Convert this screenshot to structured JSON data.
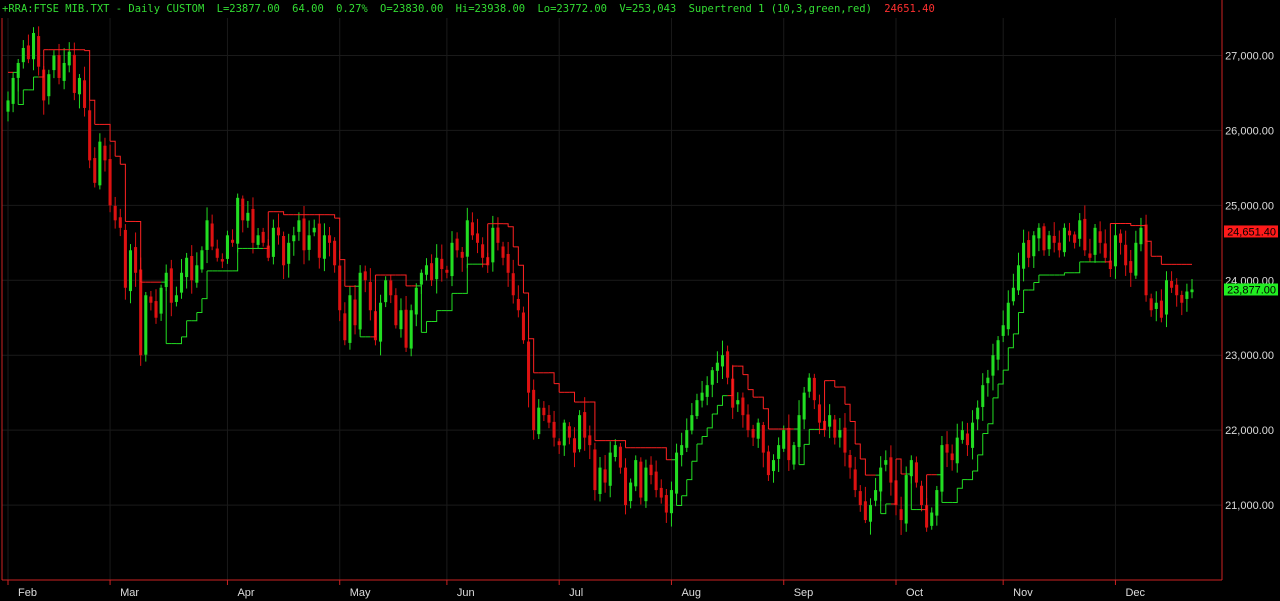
{
  "header": {
    "symbol": "+RRA:FTSE MIB.TXT - Daily  CUSTOM",
    "last": "L=23877.00",
    "change": "64.00",
    "change_pct": "0.27%",
    "open": "O=23830.00",
    "high": "Hi=23938.00",
    "low": "Lo=23772.00",
    "volume": "V=253,043",
    "indicator": "Supertrend 1 (10,3,green,red)",
    "indicator_value": "24651.40"
  },
  "colors": {
    "background": "#000000",
    "up": "#22dd22",
    "down": "#dd1111",
    "axis": "#cc2222",
    "grid": "#1a1a1a",
    "text": "#dddddd",
    "supertrend_up": "#22dd22",
    "supertrend_down": "#ff2222"
  },
  "chart_data": {
    "type": "candlestick",
    "x_ticks": [
      "Feb",
      "Mar",
      "Apr",
      "May",
      "Jun",
      "Jul",
      "Aug",
      "Sep",
      "Oct",
      "Nov",
      "Dec"
    ],
    "y_ticks": [
      "21,000.00",
      "22,000.00",
      "23,000.00",
      "24,000.00",
      "25,000.00",
      "26,000.00",
      "27,000.00"
    ],
    "ylim": [
      20000,
      27500
    ],
    "y_labels": {
      "supertrend": "24,651.40",
      "last": "23,877.00"
    },
    "supertrend_value": 24651.4,
    "last_value": 23877,
    "dates": [
      "02-01",
      "02-02",
      "02-03",
      "02-04",
      "02-05",
      "02-08",
      "02-09",
      "02-10",
      "02-11",
      "02-12",
      "02-15",
      "02-16",
      "02-17",
      "02-18",
      "02-19",
      "02-22",
      "02-23",
      "02-24",
      "02-25",
      "02-26",
      "03-01",
      "03-02",
      "03-03",
      "03-04",
      "03-05",
      "03-08",
      "03-09",
      "03-10",
      "03-11",
      "03-12",
      "03-15",
      "03-16",
      "03-17",
      "03-18",
      "03-19",
      "03-22",
      "03-23",
      "03-24",
      "03-25",
      "03-26",
      "03-29",
      "03-30",
      "03-31",
      "04-01",
      "04-02",
      "04-05",
      "04-06",
      "04-07",
      "04-08",
      "04-09",
      "04-12",
      "04-13",
      "04-14",
      "04-15",
      "04-16",
      "04-19",
      "04-20",
      "04-21",
      "04-22",
      "04-23",
      "04-26",
      "04-27",
      "04-28",
      "04-29",
      "04-30",
      "05-03",
      "05-04",
      "05-05",
      "05-06",
      "05-07",
      "05-10",
      "05-11",
      "05-12",
      "05-13",
      "05-14",
      "05-17",
      "05-18",
      "05-19",
      "05-20",
      "05-21",
      "05-24",
      "05-25",
      "05-26",
      "05-27",
      "05-28",
      "05-31",
      "06-01",
      "06-02",
      "06-03",
      "06-04",
      "06-07",
      "06-08",
      "06-09",
      "06-10",
      "06-11",
      "06-14",
      "06-15",
      "06-16",
      "06-17",
      "06-18",
      "06-21",
      "06-22",
      "06-23",
      "06-24",
      "06-25",
      "06-28",
      "06-29",
      "06-30",
      "07-01",
      "07-02",
      "07-05",
      "07-06",
      "07-07",
      "07-08",
      "07-09",
      "07-12",
      "07-13",
      "07-14",
      "07-15",
      "07-16",
      "07-19",
      "07-20",
      "07-21",
      "07-22",
      "07-23",
      "07-26",
      "07-27",
      "07-28",
      "07-29",
      "07-30",
      "08-02",
      "08-03",
      "08-04",
      "08-05",
      "08-06",
      "08-09",
      "08-10",
      "08-11",
      "08-12",
      "08-13",
      "08-16",
      "08-17",
      "08-18",
      "08-19",
      "08-20",
      "08-23",
      "08-24",
      "08-25",
      "08-26",
      "08-27",
      "08-30",
      "08-31",
      "09-01",
      "09-02",
      "09-03",
      "09-06",
      "09-07",
      "09-08",
      "09-09",
      "09-10",
      "09-13",
      "09-14",
      "09-15",
      "09-16",
      "09-17",
      "09-20",
      "09-21",
      "09-22",
      "09-23",
      "09-24",
      "09-27",
      "09-28",
      "09-29",
      "09-30",
      "10-01",
      "10-04",
      "10-05",
      "10-06",
      "10-07",
      "10-08",
      "10-11",
      "10-12",
      "10-13",
      "10-14",
      "10-15",
      "10-18",
      "10-19",
      "10-20",
      "10-21",
      "10-22",
      "10-25",
      "10-26",
      "10-27",
      "10-28",
      "10-29",
      "11-01",
      "11-02",
      "11-03",
      "11-04",
      "11-05",
      "11-08",
      "11-09",
      "11-10",
      "11-11",
      "11-12",
      "11-15",
      "11-16",
      "11-17",
      "11-18",
      "11-19",
      "11-22",
      "11-23",
      "11-24",
      "11-25",
      "11-26",
      "11-29",
      "11-30",
      "12-01",
      "12-02",
      "12-03",
      "12-06",
      "12-07",
      "12-08",
      "12-09",
      "12-10",
      "12-13",
      "12-14",
      "12-15",
      "12-16",
      "12-17",
      "12-20",
      "12-21",
      "12-22"
    ],
    "close": [
      26400,
      26700,
      26900,
      27100,
      26950,
      27300,
      26850,
      26400,
      26750,
      27000,
      26700,
      26900,
      27050,
      26500,
      26700,
      26300,
      25600,
      25300,
      25850,
      25600,
      25000,
      24800,
      24700,
      23900,
      24400,
      24100,
      23000,
      23800,
      23700,
      23500,
      23900,
      24100,
      23700,
      23800,
      24100,
      24300,
      24000,
      24200,
      24400,
      24800,
      24450,
      24300,
      24250,
      24600,
      24500,
      25100,
      24800,
      24900,
      24500,
      24600,
      24500,
      24300,
      24700,
      24600,
      24200,
      24500,
      24600,
      24800,
      24400,
      24600,
      24700,
      24300,
      24600,
      24500,
      24200,
      23600,
      23200,
      23800,
      23400,
      24100,
      24000,
      23600,
      23200,
      23700,
      24000,
      23800,
      23400,
      23600,
      23100,
      23600,
      23900,
      24100,
      24200,
      24000,
      24300,
      24150,
      24100,
      24500,
      24400,
      24300,
      24800,
      24600,
      24500,
      24300,
      24200,
      24700,
      24500,
      24300,
      24100,
      23800,
      23600,
      23200,
      22500,
      22000,
      22300,
      22200,
      22100,
      21900,
      21800,
      22100,
      21900,
      21700,
      22200,
      21900,
      21800,
      21200,
      21500,
      21300,
      21700,
      21800,
      21500,
      21000,
      21300,
      21600,
      21100,
      21500,
      21400,
      21200,
      21100,
      20900,
      21200,
      21700,
      21800,
      22000,
      22200,
      22400,
      22500,
      22600,
      22800,
      22900,
      23000,
      22700,
      22300,
      22400,
      22200,
      22000,
      21900,
      22100,
      21700,
      21400,
      21600,
      21800,
      22000,
      21600,
      21800,
      22200,
      22500,
      22700,
      22400,
      22100,
      22000,
      22200,
      21900,
      22000,
      21700,
      21500,
      21200,
      21000,
      20800,
      21000,
      21200,
      21500,
      21600,
      21300,
      21000,
      20800,
      21400,
      21600,
      21300,
      21000,
      20700,
      20900,
      21200,
      21800,
      21700,
      21600,
      21900,
      22000,
      21800,
      22100,
      22300,
      22600,
      22700,
      23000,
      23200,
      23400,
      23700,
      23900,
      24200,
      24500,
      24300,
      24600,
      24700,
      24400,
      24600,
      24500,
      24400,
      24700,
      24600,
      24500,
      24800,
      24400,
      24300,
      24700,
      24500,
      24300,
      24150,
      24600,
      24500,
      24200,
      24100,
      24500,
      24700,
      23800,
      23600,
      23700,
      23500,
      24000,
      23900,
      23800,
      23700,
      23850,
      23877
    ]
  }
}
